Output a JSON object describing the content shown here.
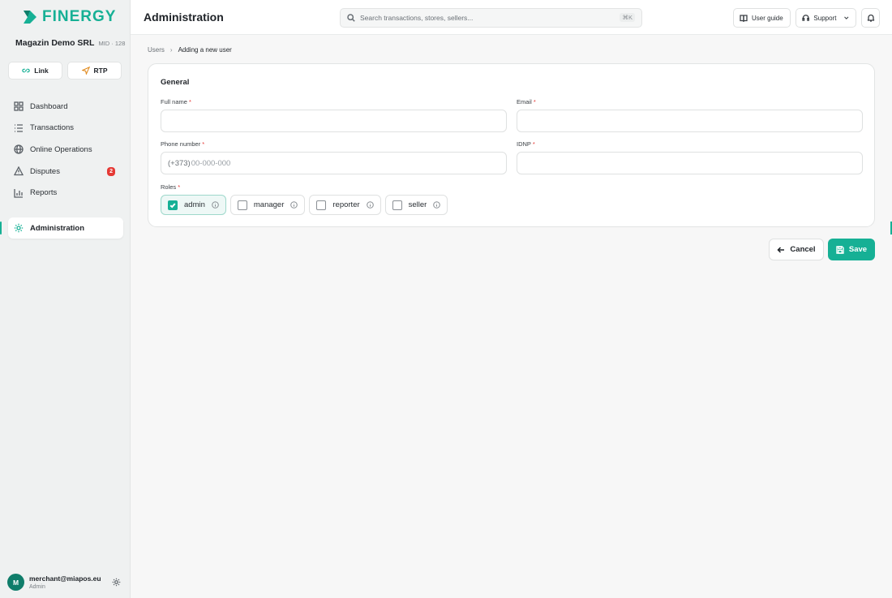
{
  "brand": {
    "name": "FINERGY",
    "accent": "#16b095"
  },
  "merchant": {
    "name": "Magazin Demo SRL",
    "mid": "MID · 128"
  },
  "quick_actions": {
    "link_label": "Link",
    "rtp_label": "RTP"
  },
  "sidebar": {
    "items": [
      {
        "label": "Dashboard",
        "icon": "dashboard-icon"
      },
      {
        "label": "Transactions",
        "icon": "list-icon"
      },
      {
        "label": "Online Operations",
        "icon": "globe-icon"
      },
      {
        "label": "Disputes",
        "icon": "warning-icon",
        "badge": "2"
      },
      {
        "label": "Reports",
        "icon": "bar-chart-icon"
      }
    ],
    "active": {
      "label": "Administration",
      "icon": "gear-icon"
    }
  },
  "user": {
    "initial": "M",
    "email": "merchant@miapos.eu",
    "role": "Admin"
  },
  "header": {
    "title": "Administration",
    "search_placeholder": "Search transactions, stores, sellers...",
    "search_shortcut": "⌘K",
    "user_guide_label": "User guide",
    "support_label": "Support"
  },
  "breadcrumb": {
    "parent": "Users",
    "separator": "›",
    "current": "Adding a new user"
  },
  "form": {
    "section_title": "General",
    "required_mark": "*",
    "full_name_label": "Full name",
    "email_label": "Email",
    "phone_label": "Phone number",
    "phone_prefix": "(+373)",
    "phone_placeholder": "00-000-000",
    "idnp_label": "IDNP",
    "roles_label": "Roles",
    "roles": [
      {
        "label": "admin",
        "checked": true
      },
      {
        "label": "manager",
        "checked": false
      },
      {
        "label": "reporter",
        "checked": false
      },
      {
        "label": "seller",
        "checked": false
      }
    ]
  },
  "actions": {
    "cancel_label": "Cancel",
    "save_label": "Save"
  }
}
